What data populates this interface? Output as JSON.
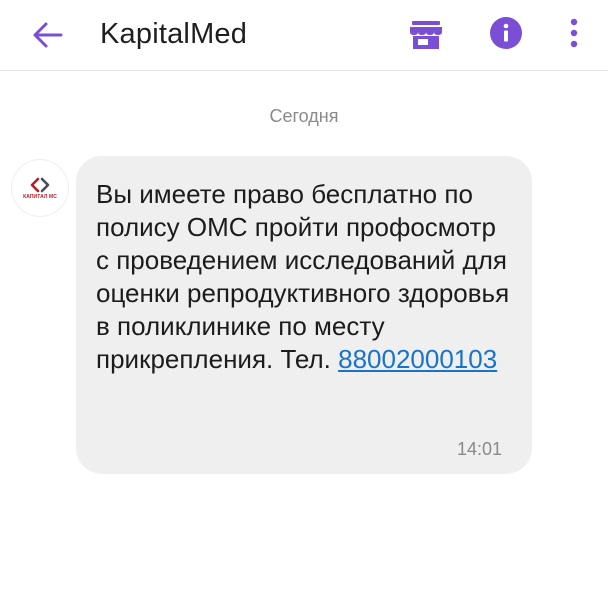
{
  "header": {
    "title": "KapitalMed",
    "back_icon": "arrow-left-icon",
    "store_icon": "storefront-icon",
    "info_icon": "info-icon",
    "more_icon": "more-vertical-icon"
  },
  "colors": {
    "accent": "#7a4fd6",
    "link": "#1a73c9",
    "bubble": "#efefef",
    "logo_red": "#b01e2a"
  },
  "date_separator": "Сегодня",
  "sender": {
    "avatar_text": "КАПИТАЛ МС",
    "avatar_icon": "capital-ms-logo-icon"
  },
  "message": {
    "text": "Вы имеете право бесплатно по полису ОМС пройти профосмотр с проведением исследований для оценки репродуктивного здоровья в поликлинике по месту прикрепления. Тел.",
    "phone": "88002000103",
    "time": "14:01"
  }
}
